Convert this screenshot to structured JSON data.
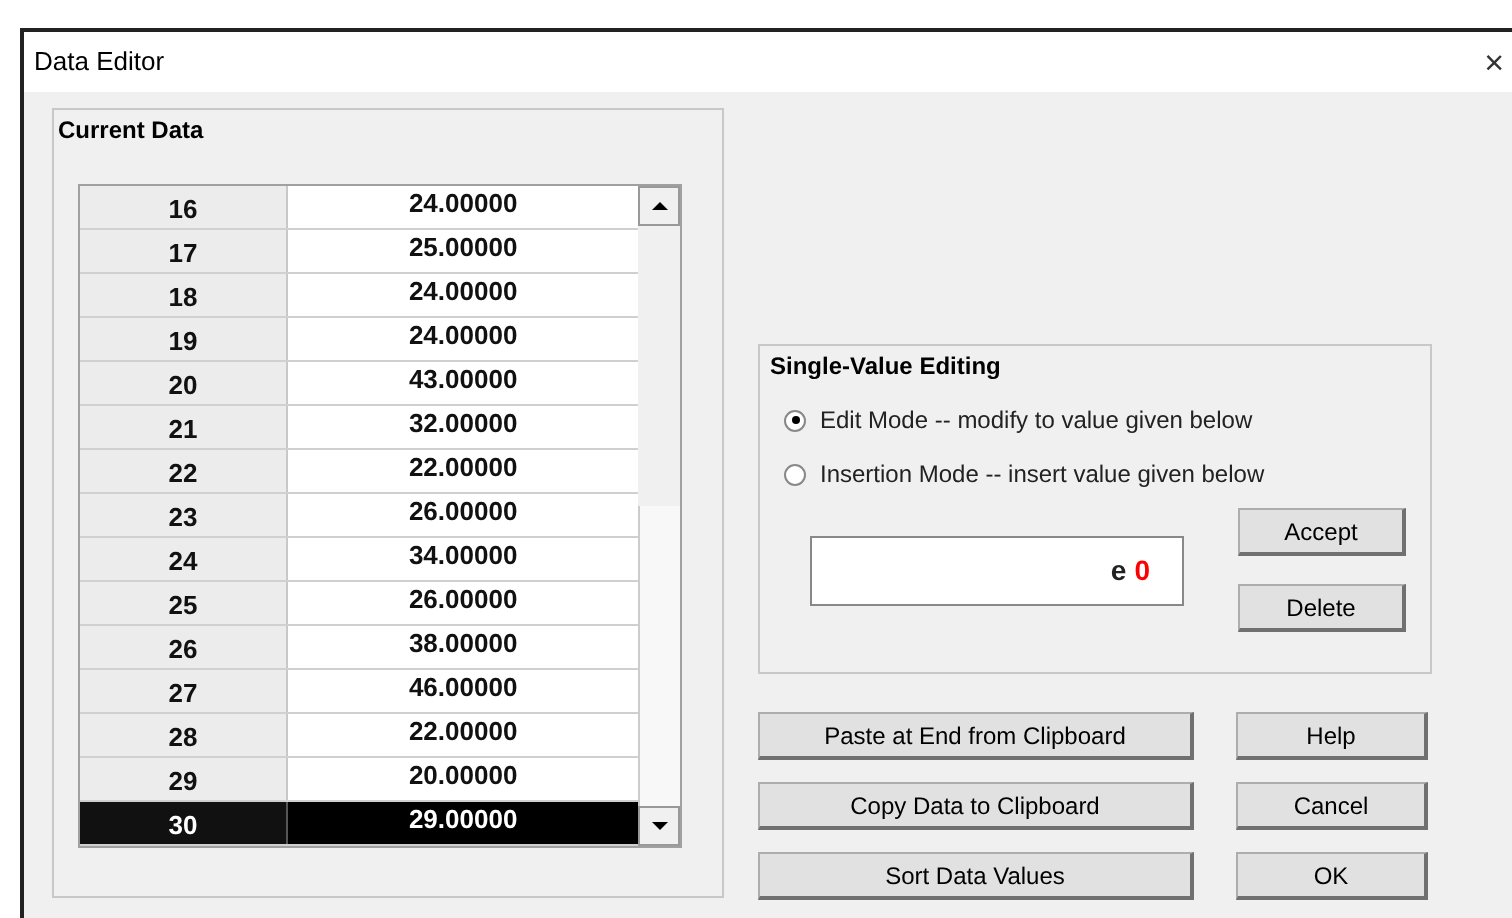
{
  "window": {
    "title": "Data Editor",
    "close": "×"
  },
  "current_data": {
    "title": "Current Data",
    "rows": [
      {
        "index": "16",
        "value": "24.00000",
        "selected": false
      },
      {
        "index": "17",
        "value": "25.00000",
        "selected": false
      },
      {
        "index": "18",
        "value": "24.00000",
        "selected": false
      },
      {
        "index": "19",
        "value": "24.00000",
        "selected": false
      },
      {
        "index": "20",
        "value": "43.00000",
        "selected": false
      },
      {
        "index": "21",
        "value": "32.00000",
        "selected": false
      },
      {
        "index": "22",
        "value": "22.00000",
        "selected": false
      },
      {
        "index": "23",
        "value": "26.00000",
        "selected": false
      },
      {
        "index": "24",
        "value": "34.00000",
        "selected": false
      },
      {
        "index": "25",
        "value": "26.00000",
        "selected": false
      },
      {
        "index": "26",
        "value": "38.00000",
        "selected": false
      },
      {
        "index": "27",
        "value": "46.00000",
        "selected": false
      },
      {
        "index": "28",
        "value": "22.00000",
        "selected": false
      },
      {
        "index": "29",
        "value": "20.00000",
        "selected": false
      },
      {
        "index": "30",
        "value": "29.00000",
        "selected": true
      }
    ]
  },
  "single_value_editing": {
    "title": "Single-Value Editing",
    "modes": [
      {
        "label": "Edit Mode -- modify to value given below",
        "selected": true
      },
      {
        "label": "Insertion Mode -- insert value given below",
        "selected": false
      }
    ],
    "field": {
      "prefix": "e",
      "value": "0"
    },
    "buttons": [
      "Accept",
      "Delete"
    ]
  },
  "actions": [
    "Paste at End from Clipboard",
    "Copy Data to Clipboard",
    "Sort Data Values"
  ],
  "dialog_buttons": [
    "Help",
    "Cancel",
    "OK"
  ]
}
